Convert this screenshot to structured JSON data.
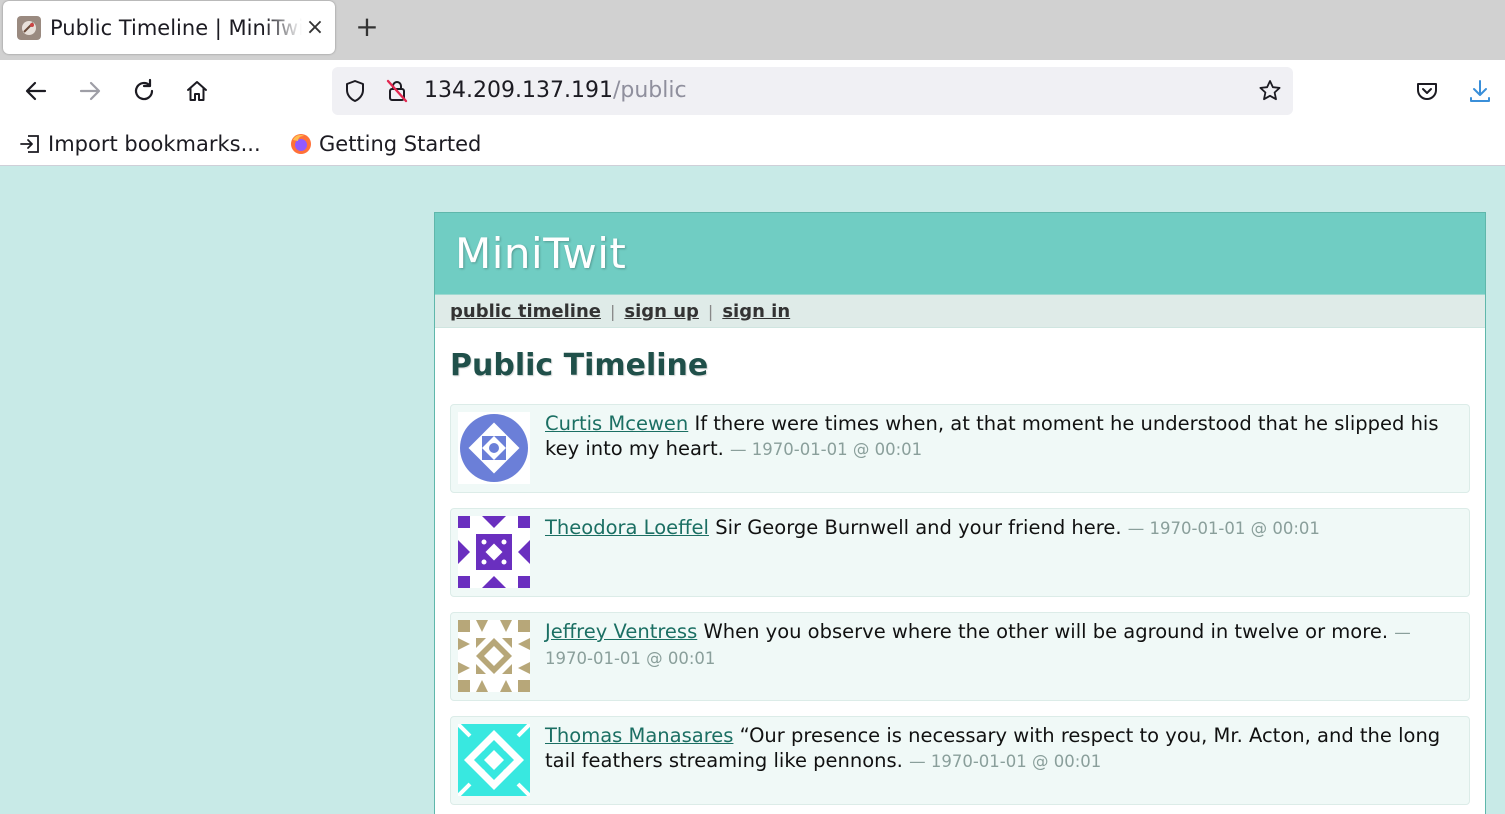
{
  "browser": {
    "tab": {
      "title": "Public Timeline | MiniTwit",
      "close_glyph": "×"
    },
    "new_tab_glyph": "+",
    "url": {
      "host": "134.209.137.191",
      "path": "/public"
    },
    "bookmarks": [
      {
        "label": "Import bookmarks...",
        "icon": "import-icon"
      },
      {
        "label": "Getting Started",
        "icon": "firefox-icon"
      }
    ]
  },
  "site": {
    "logo": "MiniTwit",
    "nav": [
      {
        "label": "public timeline"
      },
      {
        "label": "sign up"
      },
      {
        "label": "sign in"
      }
    ],
    "nav_separator": "|",
    "page_title": "Public Timeline"
  },
  "messages": [
    {
      "user": "Curtis Mcewen",
      "text": "If there were times when, at that moment he understood that he slipped his key into my heart.",
      "date": "— 1970-01-01 @ 00:01",
      "avatar_color": "#6b7fd8"
    },
    {
      "user": "Theodora Loeffel",
      "text": "Sir George Burnwell and your friend here.",
      "date": "— 1970-01-01 @ 00:01",
      "avatar_color": "#6a2fbf"
    },
    {
      "user": "Jeffrey Ventress",
      "text": "When you observe where the other will be aground in twelve or more.",
      "date": "— 1970-01-01 @ 00:01",
      "avatar_color": "#b7a779"
    },
    {
      "user": "Thomas Manasares",
      "text": "“Our presence is necessary with respect to you, Mr. Acton, and the long tail feathers streaming like pennons.",
      "date": "— 1970-01-01 @ 00:01",
      "avatar_color": "#38e8e0"
    }
  ]
}
